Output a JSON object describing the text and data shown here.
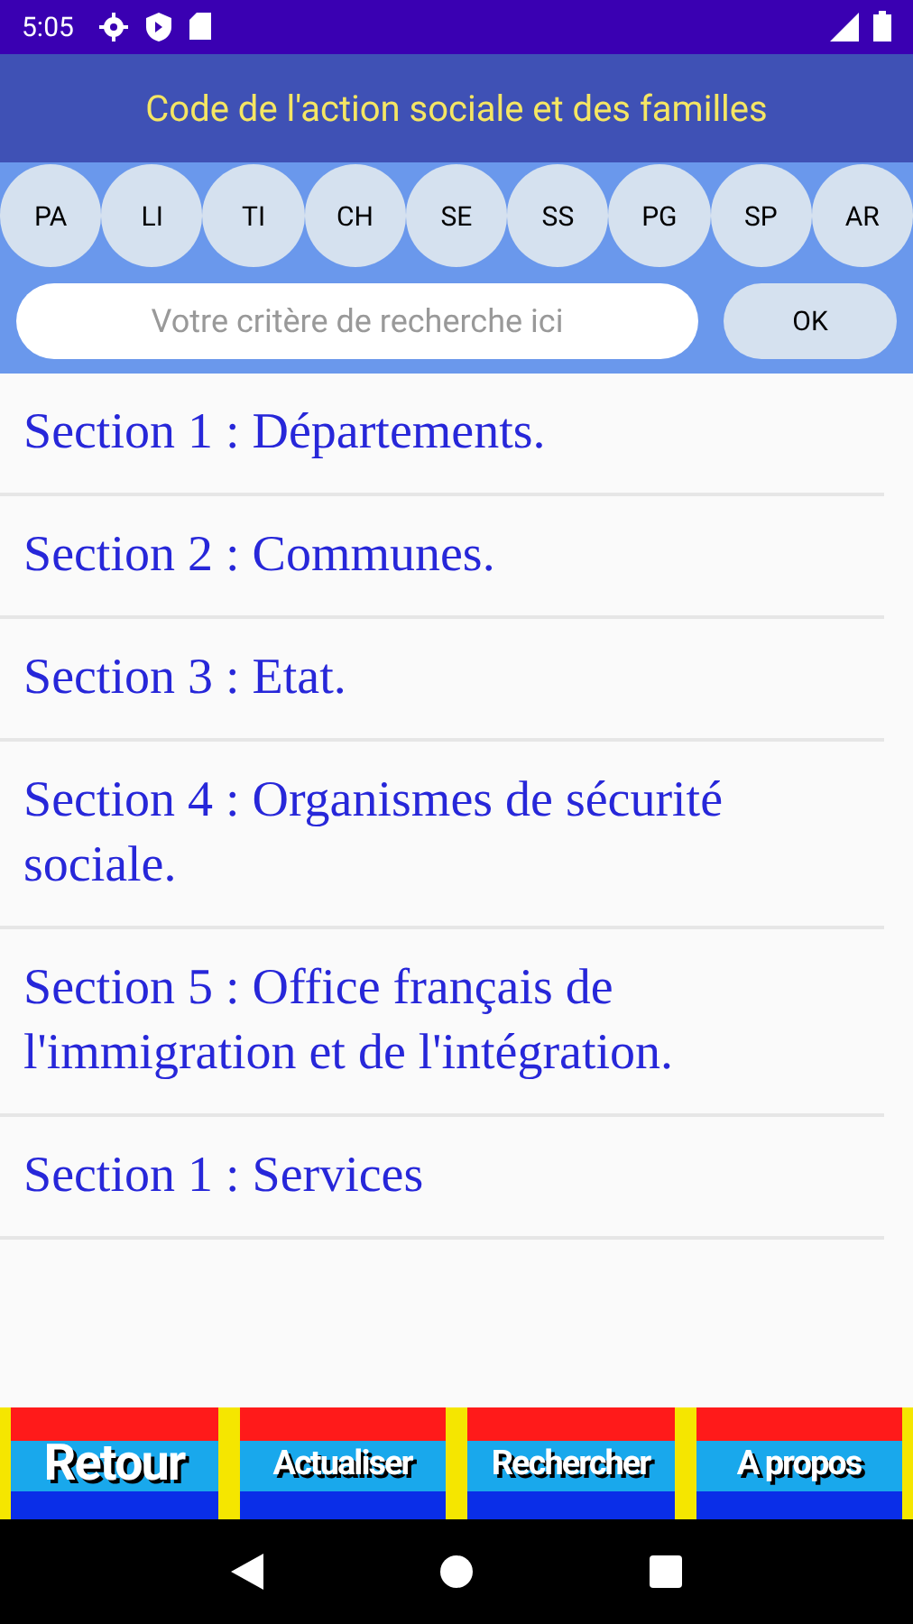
{
  "status_bar": {
    "time": "5:05"
  },
  "title": "Code de l'action sociale et des familles",
  "chips": [
    {
      "label": "PA"
    },
    {
      "label": "LI"
    },
    {
      "label": "TI"
    },
    {
      "label": "CH"
    },
    {
      "label": "SE"
    },
    {
      "label": "SS"
    },
    {
      "label": "PG"
    },
    {
      "label": "SP"
    },
    {
      "label": "AR"
    }
  ],
  "search": {
    "placeholder": "Votre critère de recherche ici",
    "button": "OK"
  },
  "sections": [
    "Section 1 : Départements.",
    "Section 2 : Communes.",
    "Section 3 : Etat.",
    "Section 4 : Organismes de sécurité sociale.",
    "Section 5 : Office français de l'immigration et de l'intégration.",
    "Section 1 : Services"
  ],
  "bottom_buttons": [
    {
      "label": "Retour",
      "kind": "large"
    },
    {
      "label": "Actualiser",
      "kind": "small"
    },
    {
      "label": "Rechercher",
      "kind": "small"
    },
    {
      "label": "A propos",
      "kind": "small"
    }
  ]
}
